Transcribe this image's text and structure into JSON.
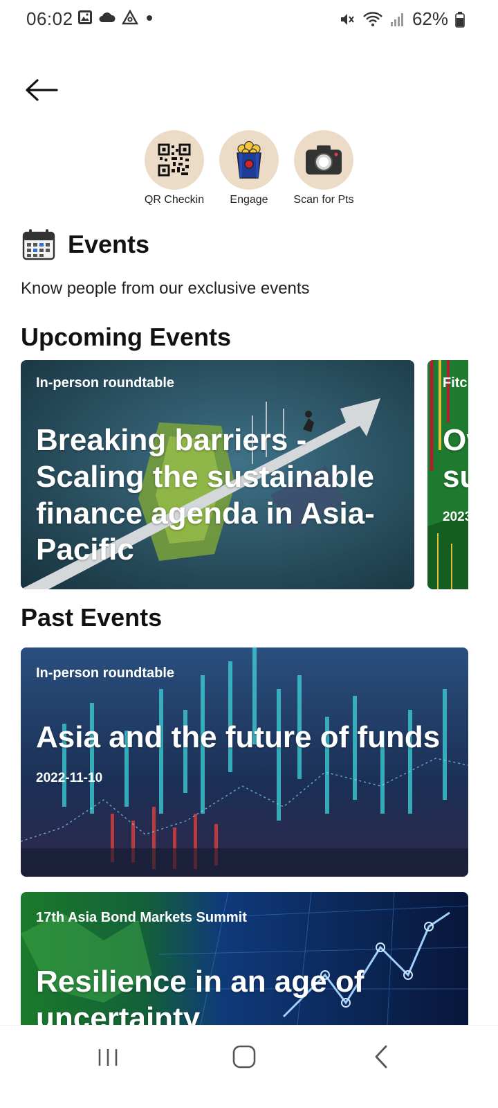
{
  "status_bar": {
    "time": "06:02",
    "battery": "62%",
    "icons_left": [
      "gallery-icon",
      "cloud-icon",
      "triangle-app-icon",
      "dot-icon"
    ],
    "icons_right": [
      "mute-icon",
      "wifi-icon",
      "signal-icon",
      "battery-icon"
    ]
  },
  "actions": [
    {
      "label": "QR Checkin",
      "icon": "qr-code-icon"
    },
    {
      "label": "Engage",
      "icon": "popcorn-icon"
    },
    {
      "label": "Scan for Pts",
      "icon": "camera-icon"
    }
  ],
  "events": {
    "title": "Events",
    "subtitle": "Know people from our exclusive events"
  },
  "upcoming": {
    "title": "Upcoming Events",
    "cards": [
      {
        "tag": "In-person roundtable",
        "title": "Breaking barriers - Scaling the sustainable finance agenda in Asia-Pacific"
      },
      {
        "tag": "Fitc",
        "title": "Ov su",
        "date": "2023"
      }
    ]
  },
  "past": {
    "title": "Past Events",
    "cards": [
      {
        "tag": "In-person roundtable",
        "title": "Asia and the future of funds",
        "date": "2022-11-10"
      },
      {
        "tag": "17th Asia Bond Markets Summit",
        "title": "Resilience in an age of uncertainty"
      }
    ]
  },
  "colors": {
    "action_bg": "#ecdcc7",
    "card1_bg": "#244a5a",
    "card2_bg": "#1e7a2e",
    "card3_bg": "#1d3a66",
    "card4_bg": "#0e2f6e"
  }
}
